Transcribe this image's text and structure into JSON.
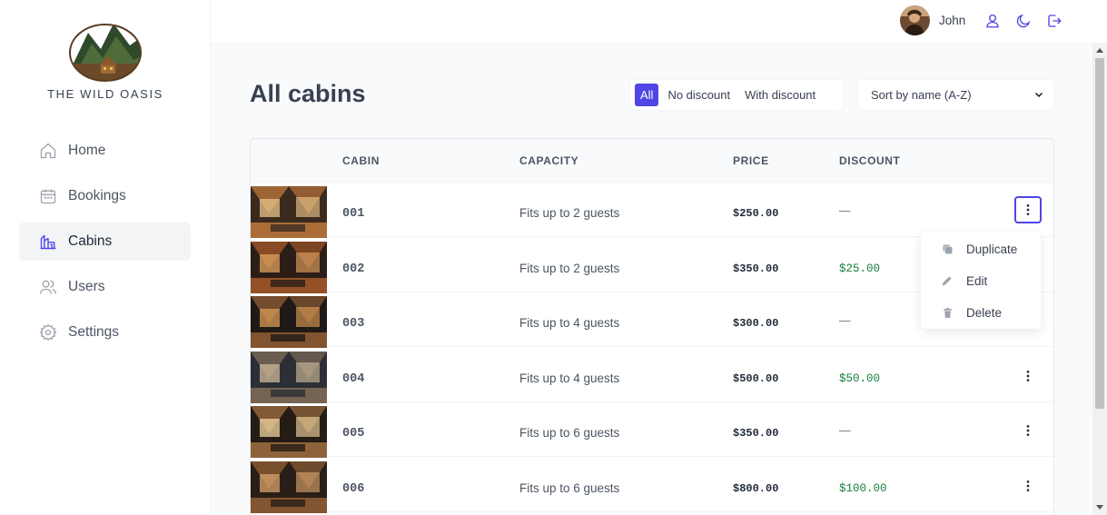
{
  "brand": {
    "name": "THE WILD OASIS"
  },
  "sidebar": {
    "items": [
      {
        "label": "Home",
        "icon": "home-icon"
      },
      {
        "label": "Bookings",
        "icon": "calendar-icon"
      },
      {
        "label": "Cabins",
        "icon": "cabins-icon",
        "active": true
      },
      {
        "label": "Users",
        "icon": "users-icon"
      },
      {
        "label": "Settings",
        "icon": "gear-icon"
      }
    ]
  },
  "header": {
    "user_name": "John",
    "icons": [
      "user-icon",
      "moon-icon",
      "logout-icon"
    ]
  },
  "main": {
    "title": "All cabins",
    "filter": {
      "options": [
        "All",
        "No discount",
        "With discount"
      ],
      "active": "All"
    },
    "sort": {
      "selected": "Sort by name (A-Z)"
    },
    "table": {
      "columns": [
        "CABIN",
        "CAPACITY",
        "PRICE",
        "DISCOUNT"
      ],
      "rows": [
        {
          "name": "001",
          "capacity": "Fits up to 2 guests",
          "price": "$250.00",
          "discount": "—"
        },
        {
          "name": "002",
          "capacity": "Fits up to 2 guests",
          "price": "$350.00",
          "discount": "$25.00"
        },
        {
          "name": "003",
          "capacity": "Fits up to 4 guests",
          "price": "$300.00",
          "discount": "—"
        },
        {
          "name": "004",
          "capacity": "Fits up to 4 guests",
          "price": "$500.00",
          "discount": "$50.00"
        },
        {
          "name": "005",
          "capacity": "Fits up to 6 guests",
          "price": "$350.00",
          "discount": "—"
        },
        {
          "name": "006",
          "capacity": "Fits up to 6 guests",
          "price": "$800.00",
          "discount": "$100.00"
        }
      ]
    },
    "context_menu": {
      "items": [
        {
          "label": "Duplicate",
          "icon": "duplicate-icon"
        },
        {
          "label": "Edit",
          "icon": "pencil-icon"
        },
        {
          "label": "Delete",
          "icon": "trash-icon"
        }
      ]
    }
  },
  "colors": {
    "accent": "#4f46e5",
    "discount": "#15803d"
  }
}
